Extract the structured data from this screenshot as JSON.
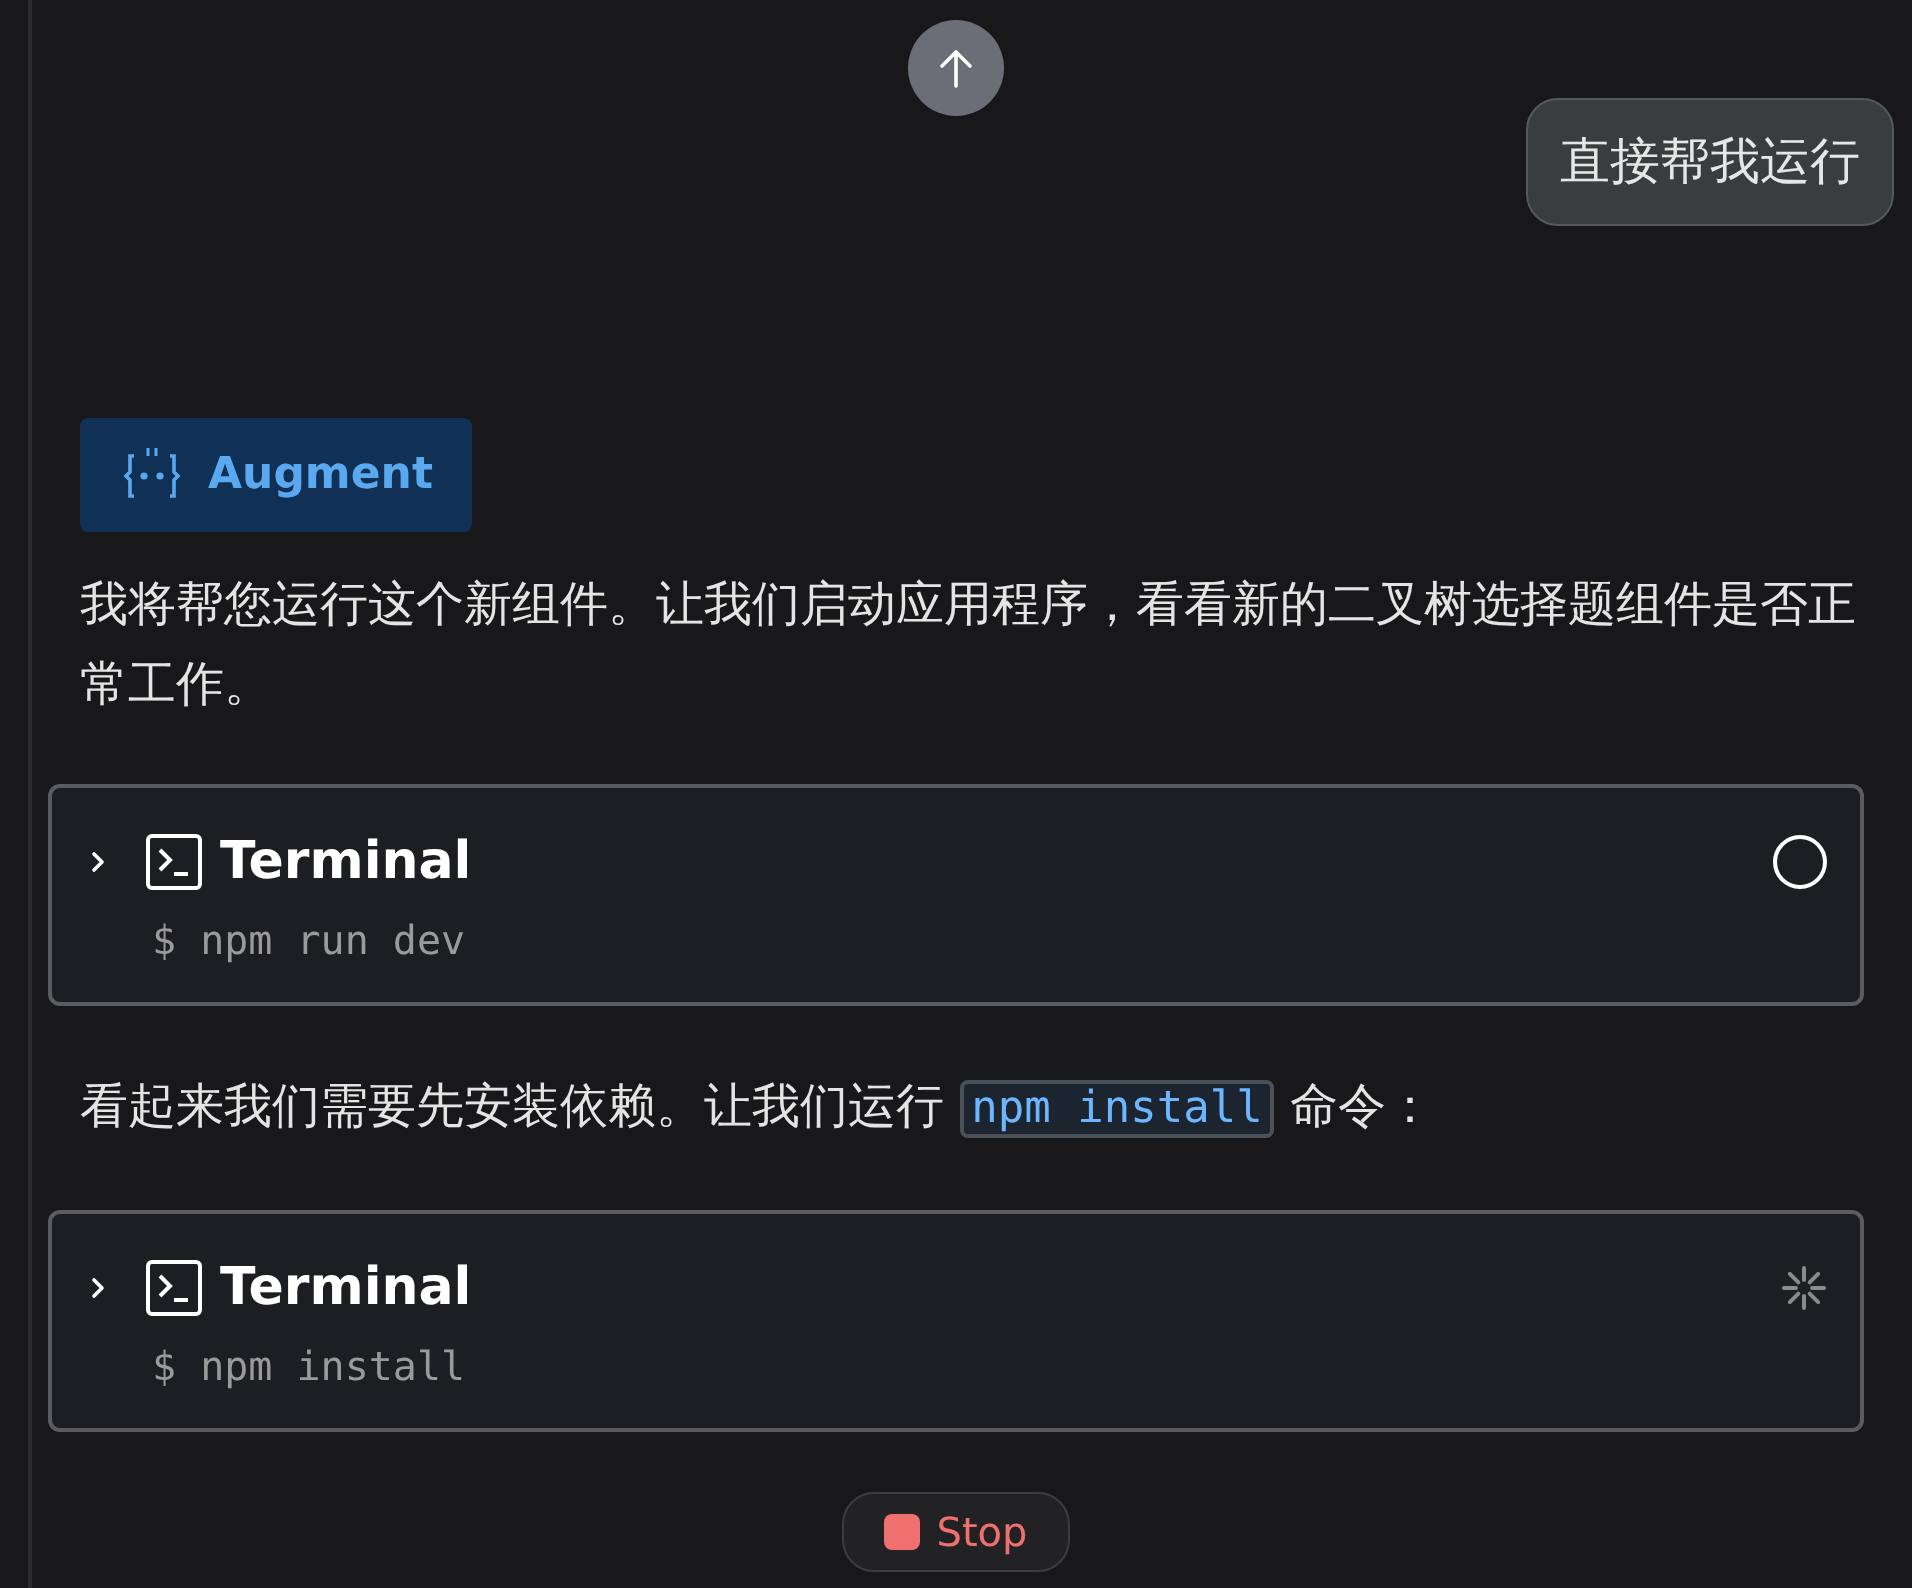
{
  "user_message": {
    "text": "直接帮我运行"
  },
  "assistant": {
    "label": "Augment"
  },
  "messages": [
    {
      "kind": "text",
      "parts": [
        {
          "kind": "text",
          "text": "我将帮您运行这个新组件。让我们启动应用程序，看看新的二叉树选择题组件是否正常工作。"
        }
      ]
    },
    {
      "kind": "terminal",
      "title": "Terminal",
      "command": "$ npm run dev",
      "running": false,
      "expanded": false
    },
    {
      "kind": "text",
      "parts": [
        {
          "kind": "text",
          "text": "看起来我们需要先安装依赖。让我们运行 "
        },
        {
          "kind": "code",
          "text": "npm install"
        },
        {
          "kind": "text",
          "text": " 命令："
        }
      ]
    },
    {
      "kind": "terminal",
      "title": "Terminal",
      "command": "$ npm install",
      "running": true,
      "expanded": false
    }
  ],
  "stop_button": {
    "label": "Stop"
  }
}
